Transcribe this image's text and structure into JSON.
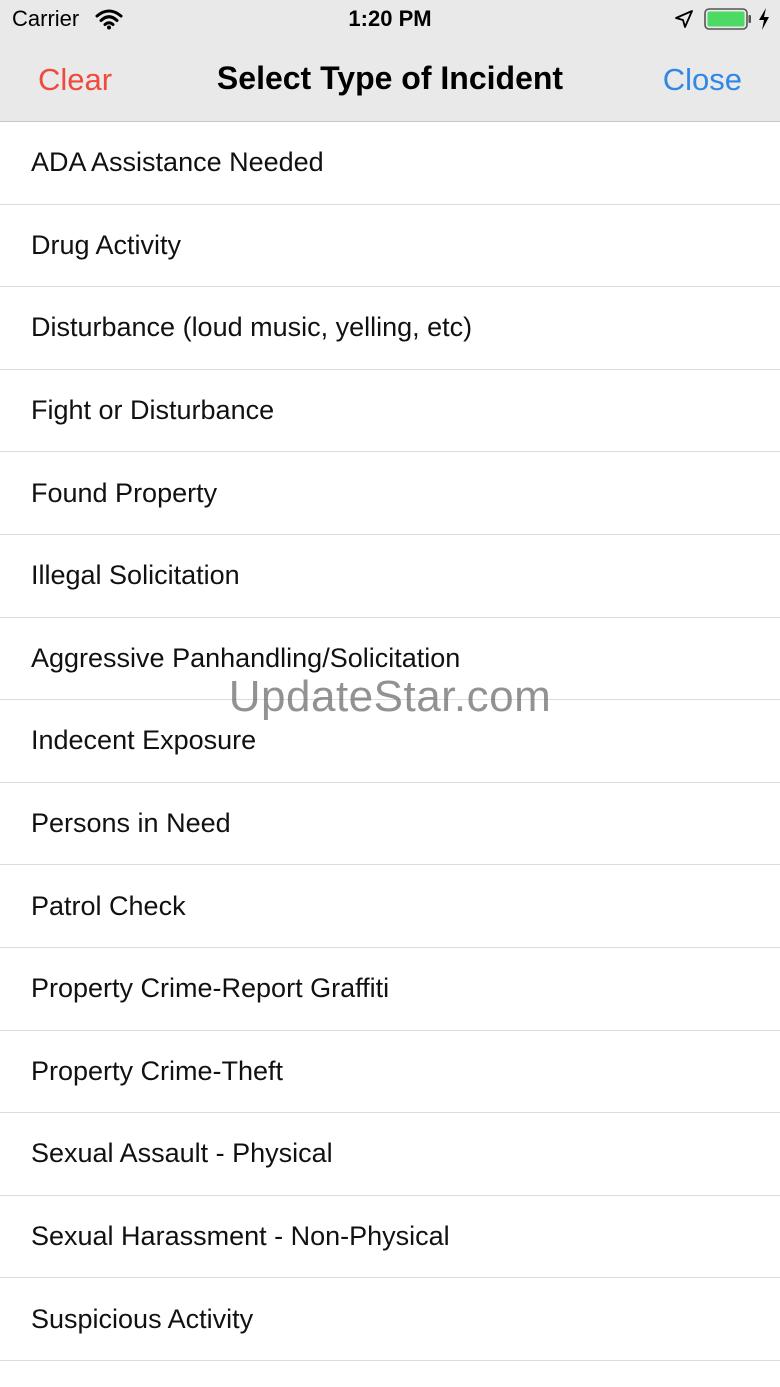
{
  "status_bar": {
    "carrier": "Carrier",
    "time": "1:20 PM",
    "icons": [
      "wifi-icon",
      "location-arrow-icon",
      "battery-icon",
      "charging-bolt-icon"
    ],
    "battery_color": "#4cd964"
  },
  "nav": {
    "clear_label": "Clear",
    "title": "Select Type of Incident",
    "close_label": "Close",
    "clear_color": "#f04a3c",
    "close_color": "#2f88e6"
  },
  "incident_types": [
    "ADA Assistance Needed",
    "Drug Activity",
    "Disturbance (loud music, yelling, etc)",
    "Fight or Disturbance",
    "Found Property",
    "Illegal Solicitation",
    "Aggressive Panhandling/Solicitation",
    "Indecent Exposure",
    "Persons in Need",
    "Patrol Check",
    "Property Crime-Report Graffiti",
    "Property Crime-Theft",
    "Sexual Assault - Physical",
    "Sexual Harassment - Non-Physical",
    "Suspicious Activity"
  ],
  "watermark": "UpdateStar.com"
}
